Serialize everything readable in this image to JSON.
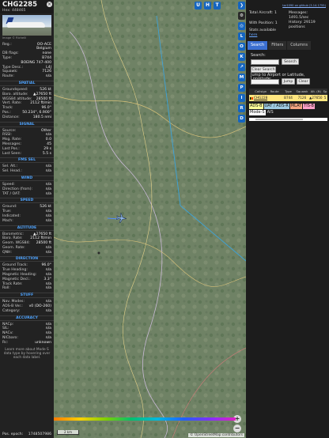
{
  "aircraft": {
    "callsign": "CHG2285",
    "hex_label": "Hex:",
    "hex": "448465",
    "photo_credit": "Image © Richelli",
    "close_icon": "close-icon",
    "fields": [
      {
        "k": "Reg.:",
        "v": "OO-ACE"
      },
      {
        "k": "",
        "v": "Belgium"
      },
      {
        "k": "DB flags:",
        "v": "none"
      },
      {
        "k": "Type:",
        "v": "B744"
      },
      {
        "k": "",
        "v": "BOEING 747-400"
      },
      {
        "k": "Type Desc.:",
        "v": "L4J"
      },
      {
        "k": "Squawk:",
        "v": "7126"
      },
      {
        "k": "Route:",
        "v": "n/a"
      }
    ]
  },
  "sections": [
    {
      "title": "SPATIAL",
      "rows": [
        {
          "k": "Groundspeed:",
          "v": "526 kt"
        },
        {
          "k": "Baro. altitude:",
          "v": "▲27650 ft"
        },
        {
          "k": "WGS84 altitude:",
          "v": "28500 ft"
        },
        {
          "k": "Vert. Rate:",
          "v": "2112 ft/min"
        },
        {
          "k": "Track:",
          "v": "96.0°"
        },
        {
          "k": "Pos.:",
          "v": "50.234°, 6.900°"
        },
        {
          "k": "Distance:",
          "v": "180.5 nmi"
        }
      ]
    },
    {
      "title": "SIGNAL",
      "rows": [
        {
          "k": "Source:",
          "v": "Other"
        },
        {
          "k": "RSSI:",
          "v": "n/a"
        },
        {
          "k": "Msg. Rate:",
          "v": "0.0"
        },
        {
          "k": "Messages:",
          "v": "45"
        },
        {
          "k": "Last Pos.:",
          "v": "29 s"
        },
        {
          "k": "Last Seen:",
          "v": "5.5 s"
        }
      ]
    },
    {
      "title": "FMS SEL",
      "rows": [
        {
          "k": "Sel. Alt.:",
          "v": "n/a"
        },
        {
          "k": "Sel. Head.:",
          "v": "n/a"
        }
      ]
    },
    {
      "title": "WIND",
      "rows": [
        {
          "k": "Speed:",
          "v": "n/a"
        },
        {
          "k": "Direction (from):",
          "v": "n/a"
        },
        {
          "k": "TAT / OAT:",
          "v": "n/a"
        }
      ]
    },
    {
      "title": "SPEED",
      "rows": [
        {
          "k": "Ground:",
          "v": "526 kt"
        },
        {
          "k": "True:",
          "v": "n/a"
        },
        {
          "k": "Indicated:",
          "v": "n/a"
        },
        {
          "k": "Mach:",
          "v": "n/a"
        }
      ]
    },
    {
      "title": "ALTITUDE",
      "rows": [
        {
          "k": "Barometric:",
          "v": "▲27650 ft"
        },
        {
          "k": "Baro. Rate:",
          "v": "2112 ft/min"
        },
        {
          "k": "Geom. WGS84:",
          "v": "28500 ft"
        },
        {
          "k": "Geom. Rate:",
          "v": "n/a"
        },
        {
          "k": "QNH:",
          "v": "n/a"
        }
      ]
    },
    {
      "title": "DIRECTION",
      "rows": [
        {
          "k": "Ground Track:",
          "v": "96.0°"
        },
        {
          "k": "True Heading:",
          "v": "n/a"
        },
        {
          "k": "Magnetic Heading:",
          "v": "n/a"
        },
        {
          "k": "Magnetic Decl.:",
          "v": "3.3°"
        },
        {
          "k": "Track Rate:",
          "v": "n/a"
        },
        {
          "k": "Roll:",
          "v": "n/a"
        }
      ]
    },
    {
      "title": "STUFF",
      "rows": [
        {
          "k": "Nav. Modes:",
          "v": "n/a"
        },
        {
          "k": "ADS-B Ver.:",
          "v": "v0 (DO-260)"
        },
        {
          "k": "Category:",
          "v": "n/a"
        }
      ]
    },
    {
      "title": "ACCURACY",
      "rows": [
        {
          "k": "NACp:",
          "v": "n/a"
        },
        {
          "k": "SIL:",
          "v": "n/a"
        },
        {
          "k": "NACv:",
          "v": "n/a"
        },
        {
          "k": "NICbaro:",
          "v": "n/a"
        },
        {
          "k": "Rc:",
          "v": "unknown"
        }
      ]
    }
  ],
  "learn_more": "Learn more about Mode S data type by hovering over each data label.",
  "epoch": {
    "k": "Pos. epoch:",
    "v": "1748507986"
  },
  "map": {
    "top_buttons": [
      "U",
      "H",
      "T"
    ],
    "zoom_in": "+",
    "zoom_out": "−",
    "scale": "2 km",
    "attribution": "© OpenStreetMap contributors",
    "alt_ticks": [
      "",
      "",
      "",
      "",
      "",
      "",
      "",
      "",
      "",
      ""
    ]
  },
  "side_buttons": [
    "",
    "L",
    "O",
    "K",
    "M",
    "P",
    "I",
    "R",
    "D"
  ],
  "right": {
    "github": "tar1090 on github (3.14.1755)",
    "total_label": "Total Aircraft: 1",
    "pos_label": "With Position: 1",
    "stats_label": "Stats available",
    "stats_link": "here",
    "messages_label": "Messages:",
    "messages_value": "1491.5/sec",
    "history_label": "History: 29119 positions",
    "tabs": [
      "Search",
      "Filters",
      "Columns"
    ],
    "search_label": "Search:",
    "search_btn": "Search",
    "clear_search_btn": "Clear Search",
    "jump_label": "Jump to Airport or Latitude, Longitude:",
    "jump_btn": "Jump",
    "clear_btn": "Clear",
    "table_headers": [
      "Callsign",
      "Route",
      "Type",
      "Squawk",
      "Alt. (ft)",
      "Sp"
    ],
    "table_rows": [
      [
        "CHG2285",
        "",
        "B744",
        "7126",
        "▲27650",
        "5"
      ]
    ],
    "legend": [
      "ADS-B",
      "UAT / ADS-R",
      "MLAT",
      "TIS-B",
      "Mode-S",
      "AIS"
    ],
    "legend_colors": [
      "#ffff99",
      "#9ecae1",
      "#f4a582",
      "#ffa0c8",
      "#ffffff",
      "#ffffff"
    ]
  }
}
